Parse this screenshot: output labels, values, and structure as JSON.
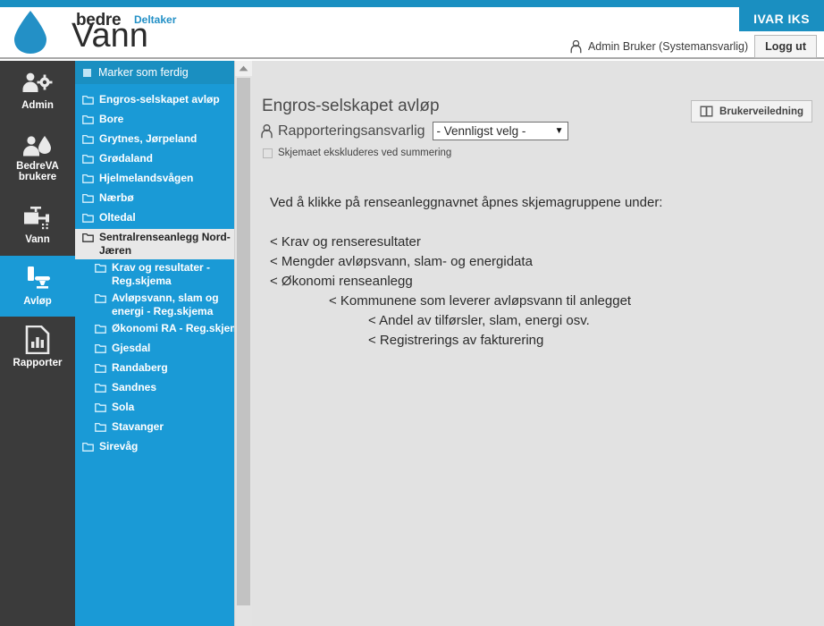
{
  "header": {
    "logo": {
      "bedre": "bedre",
      "vann": "Vann",
      "deltaker": "Deltaker",
      "drop_icon": "water-drop-icon"
    },
    "org_tab": "IVAR IKS",
    "user_name": "Admin Bruker (Systemansvarlig)",
    "user_icon": "person-icon",
    "logout_label": "Logg ut"
  },
  "leftnav": {
    "items": [
      {
        "label": "Admin",
        "icon": "admin-users-gear-icon",
        "active": false
      },
      {
        "label": "BedreVA brukere",
        "icon": "person-drop-icon",
        "active": false
      },
      {
        "label": "Vann",
        "icon": "faucet-icon",
        "active": false
      },
      {
        "label": "Avløp",
        "icon": "toilet-icon",
        "active": true
      },
      {
        "label": "Rapporter",
        "icon": "bar-chart-document-icon",
        "active": false
      }
    ]
  },
  "tree": {
    "header_label": "Marker som ferdig",
    "header_icon": "checkbox-filled-icon",
    "items": [
      {
        "label": "Engros-selskapet avløp",
        "level": 1,
        "selected": false
      },
      {
        "label": "Bore",
        "level": 1,
        "selected": false
      },
      {
        "label": "Grytnes, Jørpeland",
        "level": 1,
        "selected": false
      },
      {
        "label": "Grødaland",
        "level": 1,
        "selected": false
      },
      {
        "label": "Hjelmelandsvågen",
        "level": 1,
        "selected": false
      },
      {
        "label": "Nærbø",
        "level": 1,
        "selected": false
      },
      {
        "label": "Oltedal",
        "level": 1,
        "selected": false
      },
      {
        "label": "Sentralrenseanlegg Nord-Jæren",
        "level": 1,
        "selected": true
      },
      {
        "label": "Krav og resultater - Reg.skjema",
        "level": 2,
        "selected": false
      },
      {
        "label": "Avløpsvann, slam og energi - Reg.skjema",
        "level": 2,
        "selected": false
      },
      {
        "label": "Økonomi RA - Reg.skjema",
        "level": 2,
        "selected": false
      },
      {
        "label": "Gjesdal",
        "level": 2,
        "selected": false
      },
      {
        "label": "Randaberg",
        "level": 2,
        "selected": false
      },
      {
        "label": "Sandnes",
        "level": 2,
        "selected": false
      },
      {
        "label": "Sola",
        "level": 2,
        "selected": false
      },
      {
        "label": "Stavanger",
        "level": 2,
        "selected": false
      },
      {
        "label": "Sirevåg",
        "level": 1,
        "selected": false
      }
    ]
  },
  "scrollbar": {
    "up_icon": "chevron-up-icon"
  },
  "main": {
    "page_title": "Engros-selskapet avløp",
    "responsible_icon": "person-icon",
    "responsible_label": "Rapporteringsansvarlig",
    "responsible_value": "- Vennligst velg -",
    "responsible_caret": "▼",
    "exclude_label": "Skjemaet ekskluderes ved summering",
    "guide_label": "Brukerveiledning",
    "guide_icon": "book-icon",
    "intro": "Ved å klikke på renseanleggnavnet åpnes skjemagruppene under:",
    "lines": [
      {
        "text": "< Krav og renseresultater",
        "indent": 1
      },
      {
        "text": "< Mengder avløpsvann, slam- og energidata",
        "indent": 1
      },
      {
        "text": "< Økonomi renseanlegg",
        "indent": 1
      },
      {
        "text": "< Kommunene som leverer avløpsvann til anlegget",
        "indent": 2
      },
      {
        "text": "< Andel av tilførsler, slam, energi osv.",
        "indent": 3
      },
      {
        "text": "< Registrerings av fakturering",
        "indent": 3
      }
    ]
  },
  "colors": {
    "accent_blue": "#1a9ad6",
    "header_blue": "#1a8fc1",
    "nav_dark": "#3b3b3b",
    "content_bg": "#e2e2e2"
  }
}
